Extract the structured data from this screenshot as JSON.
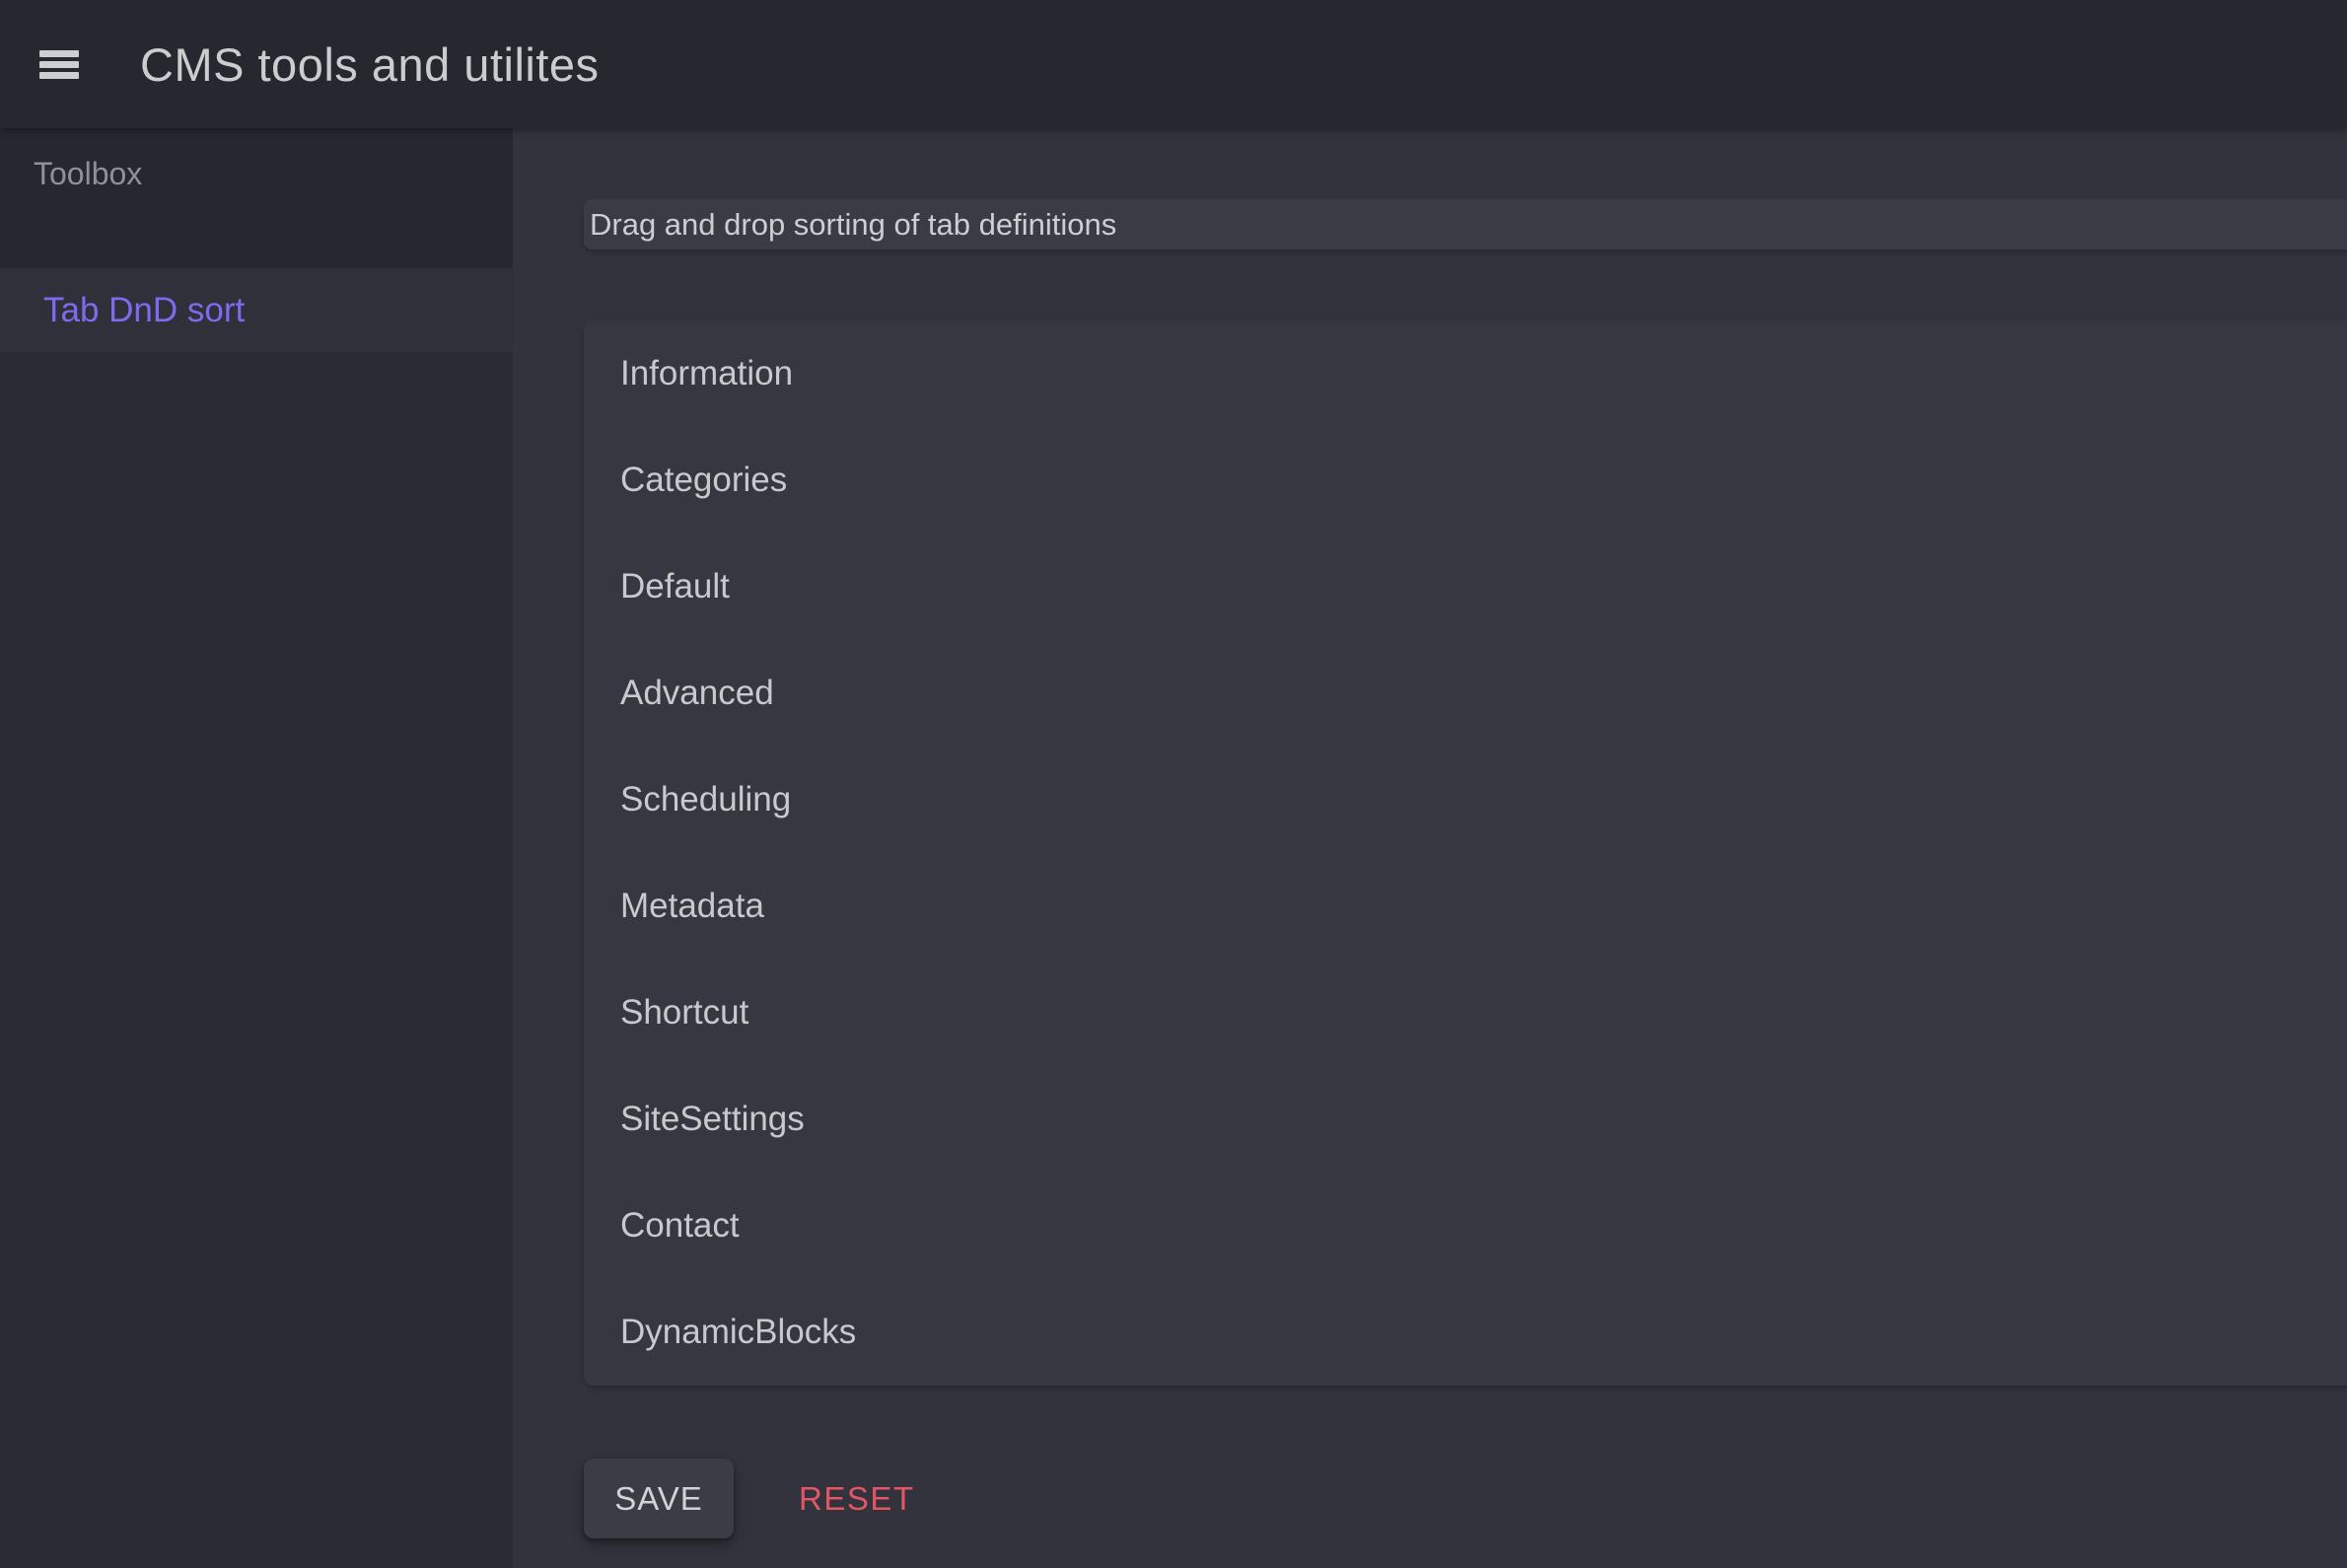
{
  "app": {
    "title": "CMS tools and utilites"
  },
  "sidebar": {
    "section_label": "Toolbox",
    "items": [
      {
        "label": "Tab DnD sort",
        "active": true
      }
    ]
  },
  "main": {
    "panel_title": "Drag and drop sorting of tab definitions",
    "tabs": [
      "Information",
      "Categories",
      "Default",
      "Advanced",
      "Scheduling",
      "Metadata",
      "Shortcut",
      "SiteSettings",
      "Contact",
      "DynamicBlocks"
    ],
    "actions": {
      "save_label": "SAVE",
      "reset_label": "RESET"
    }
  },
  "colors": {
    "accent_purple": "#7b6cee",
    "reset_red": "#e25763",
    "topbar_bg": "#26272f",
    "sidebar_bg": "#2a2b33",
    "main_bg": "#32333c",
    "panel_bg": "#363740"
  }
}
